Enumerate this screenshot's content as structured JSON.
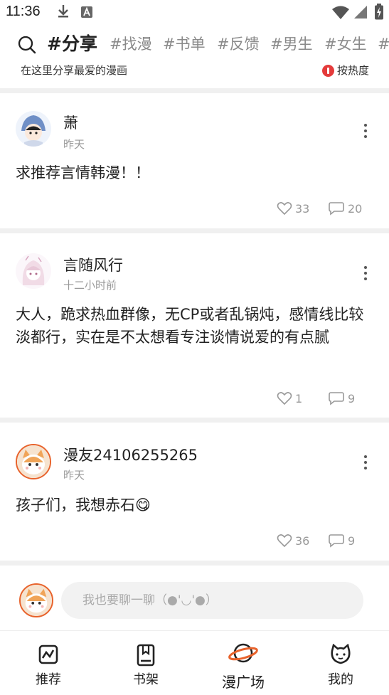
{
  "status_bar": {
    "time": "11:36"
  },
  "top_tabs": [
    "#分享",
    "#找漫",
    "#书单",
    "#反馈",
    "#男生",
    "#女生",
    "#"
  ],
  "sub_header": {
    "description": "在这里分享最爱的漫画",
    "sort_label": "按热度"
  },
  "posts": [
    {
      "username": "萧",
      "time": "昨天",
      "text": "求推荐言情韩漫！！",
      "likes": "33",
      "comments": "20"
    },
    {
      "username": "言随风行",
      "time": "十二小时前",
      "text": "大人，跪求热血群像，无CP或者乱锅炖，感情线比较淡都行，实在是不太想看专注谈情说爱的有点腻",
      "likes": "1",
      "comments": "9"
    },
    {
      "username": "漫友24106255265",
      "time": "昨天",
      "text": "孩子们，我想赤石😋",
      "likes": "36",
      "comments": "9"
    }
  ],
  "comment_bar": {
    "placeholder": "我也要聊一聊（●'◡'●）"
  },
  "bottom_nav": [
    {
      "label": "推荐",
      "icon": "recommend-icon"
    },
    {
      "label": "书架",
      "icon": "bookshelf-icon"
    },
    {
      "label": "漫广场",
      "icon": "planet-icon"
    },
    {
      "label": "我的",
      "icon": "cat-face-icon"
    }
  ],
  "colors": {
    "accent_orange": "#e8632c",
    "sort_red": "#e43b3b",
    "separator": "#f0f0f0"
  }
}
